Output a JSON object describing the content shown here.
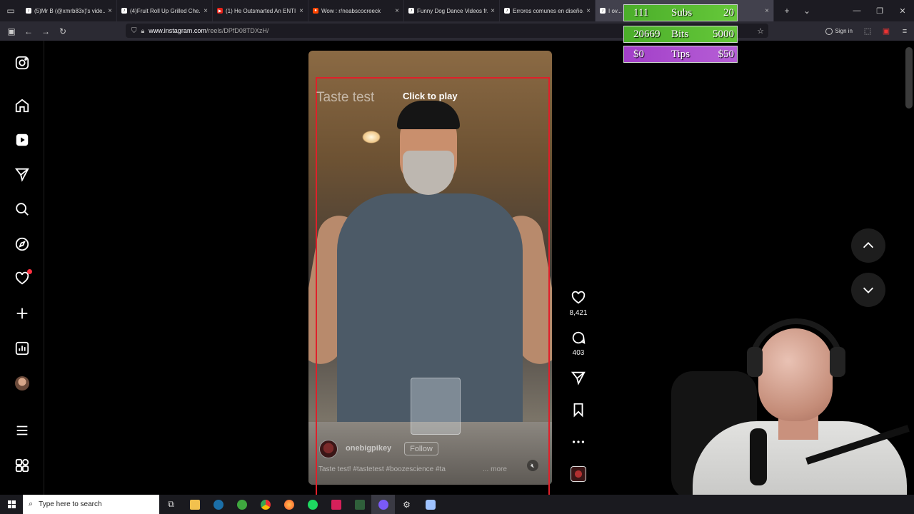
{
  "browser": {
    "tabs": [
      {
        "title": "(5)Mr B (@xmrb83x)'s vide...",
        "favicon": "tiktok-icon"
      },
      {
        "title": "(4)Fruit Roll Up Grilled Che...",
        "favicon": "tiktok-icon"
      },
      {
        "title": "(1) He Outsmarted An ENTI...",
        "favicon": "youtube-icon"
      },
      {
        "title": "Wow : r/neabscocreeck",
        "favicon": "reddit-icon"
      },
      {
        "title": "Funny Dog Dance Videos fr...",
        "favicon": "tiktok-icon"
      },
      {
        "title": "Errores comunes en diseño...",
        "favicon": "tiktok-icon"
      },
      {
        "title": "I ov...",
        "favicon": "tiktok-icon"
      }
    ],
    "url_host": "www.instagram.com",
    "url_path": "/reels/DPfD08TDXzH/",
    "signin_label": "Sign in"
  },
  "reel": {
    "overlay_title": "Taste test",
    "click_to_play": "Click to play",
    "username": "onebigpikey",
    "follow_label": "Follow",
    "caption": "Taste test! #tastetest #boozescience #ta",
    "more_label": "... more",
    "likes": "8,421",
    "comments": "403"
  },
  "stream_overlay": {
    "subs": {
      "count": "111",
      "label": "Subs",
      "goal": "20"
    },
    "bits": {
      "count": "20669",
      "label": "Bits",
      "goal": "5000"
    },
    "tips": {
      "count": "$0",
      "label": "Tips",
      "goal": "$50"
    }
  },
  "taskbar": {
    "search_placeholder": "Type here to search"
  },
  "colors": {
    "accent_red": "#e0202a",
    "overlay_green": "#55b830",
    "overlay_purple": "#a94acc",
    "notification": "#ff3040"
  }
}
